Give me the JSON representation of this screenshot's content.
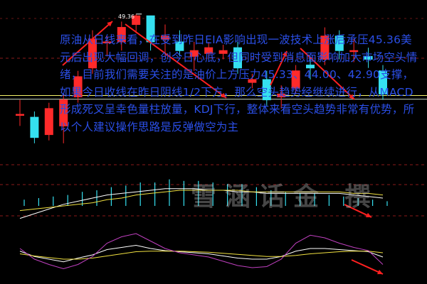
{
  "commentary": "原油从日线来看，在受到昨日EIA影响出现一波技术上涨后承压45.36美元后出现大幅回调，创今日心底，但同时受到消息面影响加大市场空头情绪，目前我们需要关注的是油价上方压力45.33、44.00、42.90支撑，如果今日收线在昨日阴线1/2下方，那么空头趋势经继续进行，从MACD形成死叉呈幸色量柱放量，KDJ下行，整体来看空头趋势非常有优势，所以个人建议操作思路是反弹做空为主",
  "watermark": "雪涵话金 撰",
  "colors": {
    "up": "#ff2a2a",
    "down": "#35e0f0",
    "up_border": "#ff2a2a",
    "hline1": "#f4f26a",
    "hline2": "#c8d8c8",
    "arrow": "#ff2020",
    "grid": "#8b1a1a",
    "macd_dif": "#ffffff",
    "macd_dea": "#f0e040",
    "kdj_k": "#ffffff",
    "kdj_d": "#f0e040",
    "kdj_j": "#c040c0",
    "volume_bar": "#35e0f0"
  },
  "chart_data": [
    {
      "type": "candlestick",
      "title": "",
      "peak_label": "49.36",
      "candles": [
        {
          "open": 45.9,
          "close": 45.9,
          "high": 46.4,
          "low": 45.5
        },
        {
          "open": 45.8,
          "close": 45.1,
          "high": 46.0,
          "low": 44.9
        },
        {
          "open": 45.2,
          "close": 46.1,
          "high": 46.3,
          "low": 45.0
        },
        {
          "open": 45.5,
          "close": 46.4,
          "high": 46.6,
          "low": 44.9
        },
        {
          "open": 46.5,
          "close": 47.2,
          "high": 47.4,
          "low": 46.3
        },
        {
          "open": 47.5,
          "close": 48.5,
          "high": 48.8,
          "low": 47.3
        },
        {
          "open": 48.4,
          "close": 48.4,
          "high": 48.6,
          "low": 47.9
        },
        {
          "open": 48.4,
          "close": 48.9,
          "high": 49.1,
          "low": 48.1
        },
        {
          "open": 49.0,
          "close": 49.3,
          "high": 49.36,
          "low": 48.7
        },
        {
          "open": 49.3,
          "close": 48.4,
          "high": 49.3,
          "low": 48.1
        },
        {
          "open": 48.5,
          "close": 48.6,
          "high": 49.0,
          "low": 47.9
        },
        {
          "open": 48.4,
          "close": 48.1,
          "high": 48.8,
          "low": 47.9
        },
        {
          "open": 47.9,
          "close": 48.1,
          "high": 48.4,
          "low": 47.4
        },
        {
          "open": 48.0,
          "close": 48.2,
          "high": 48.4,
          "low": 47.8
        },
        {
          "open": 48.0,
          "close": 48.1,
          "high": 48.3,
          "low": 47.8
        },
        {
          "open": 48.2,
          "close": 47.5,
          "high": 48.4,
          "low": 47.3
        },
        {
          "open": 47.0,
          "close": 47.1,
          "high": 47.3,
          "low": 46.8
        },
        {
          "open": 47.1,
          "close": 46.4,
          "high": 47.4,
          "low": 46.2
        },
        {
          "open": 46.5,
          "close": 46.6,
          "high": 46.9,
          "low": 46.1
        },
        {
          "open": 46.8,
          "close": 47.4,
          "high": 47.6,
          "low": 46.6
        },
        {
          "open": 47.6,
          "close": 47.5,
          "high": 47.9,
          "low": 47.1
        },
        {
          "open": 47.8,
          "close": 48.6,
          "high": 48.9,
          "low": 47.6
        },
        {
          "open": 48.6,
          "close": 48.1,
          "high": 48.8,
          "low": 47.8
        },
        {
          "open": 48.1,
          "close": 48.1,
          "high": 48.5,
          "low": 47.7
        },
        {
          "open": 47.9,
          "close": 47.8,
          "high": 48.2,
          "low": 47.5
        },
        {
          "open": 47.4,
          "close": 46.6,
          "high": 47.6,
          "low": 46.4
        }
      ],
      "price_range": [
        44.7,
        49.6
      ],
      "horizontal_lines": [
        46.55,
        46.42
      ]
    },
    {
      "type": "bar",
      "title": "",
      "series": [
        {
          "values": [
            0.4,
            0.5,
            0.6,
            0.7,
            0.9,
            1.0,
            1.2,
            1.3,
            1.5,
            1.5,
            1.7,
            1.6,
            1.6,
            1.5,
            1.4,
            1.4,
            1.2,
            1.0,
            0.9,
            0.8,
            0.8,
            0.7,
            0.6,
            0.5,
            0.4,
            0.3
          ]
        }
      ],
      "lines": [
        {
          "values": [
            -0.8,
            -0.5,
            -0.2,
            0.1,
            0.3,
            0.5,
            0.7,
            0.8,
            0.9,
            1.0,
            1.1,
            1.1,
            1.1,
            1.0,
            1.0,
            0.9,
            0.9,
            0.8,
            0.8,
            0.8,
            0.8,
            0.8,
            0.8,
            0.7,
            0.6,
            0.5
          ]
        },
        {
          "values": [
            -0.3,
            -0.2,
            -0.1,
            0.0,
            0.1,
            0.2,
            0.4,
            0.5,
            0.7,
            0.8,
            0.9,
            1.0,
            1.0,
            1.0,
            1.0,
            1.0,
            0.9,
            0.9,
            0.9,
            0.9,
            0.9,
            0.9,
            0.9,
            0.8,
            0.8,
            0.7
          ]
        }
      ],
      "ylim": [
        -1.5,
        2.0
      ]
    },
    {
      "type": "line",
      "title": "",
      "series": [
        {
          "values": [
            55,
            45,
            40,
            35,
            42,
            48,
            58,
            62,
            66,
            60,
            56,
            54,
            52,
            50,
            46,
            42,
            40,
            40,
            45,
            55,
            60,
            60,
            58,
            56,
            54,
            44
          ]
        },
        {
          "values": [
            50,
            46,
            43,
            40,
            40,
            42,
            46,
            50,
            54,
            55,
            55,
            55,
            54,
            53,
            51,
            49,
            47,
            45,
            45,
            47,
            50,
            52,
            54,
            55,
            55,
            52
          ]
        },
        {
          "values": [
            60,
            40,
            30,
            22,
            30,
            45,
            70,
            82,
            88,
            74,
            60,
            52,
            48,
            44,
            36,
            28,
            24,
            26,
            40,
            70,
            85,
            80,
            70,
            62,
            56,
            30
          ]
        }
      ],
      "ylim": [
        0,
        100
      ]
    }
  ]
}
